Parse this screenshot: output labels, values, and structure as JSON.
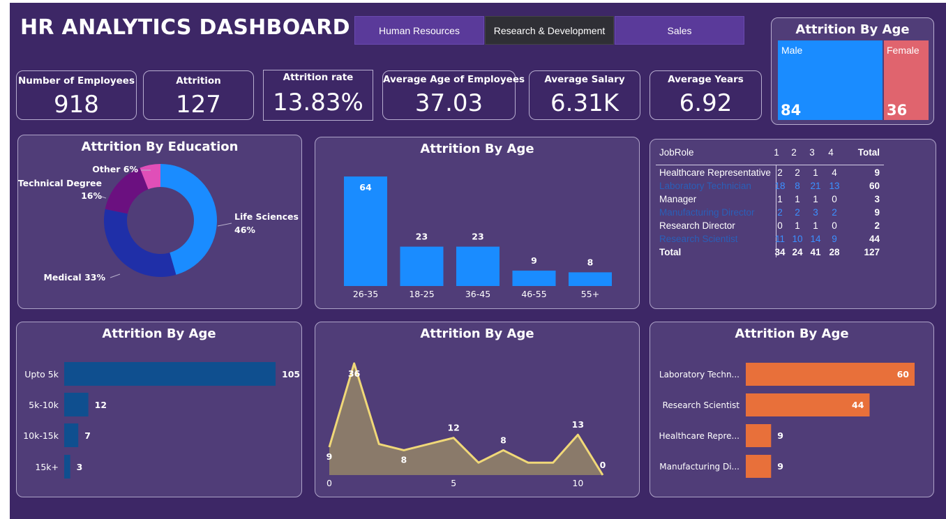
{
  "title": "HR ANALYTICS DASHBOARD",
  "tabs": [
    "Human Resources",
    "Research & Development",
    "Sales"
  ],
  "kpis": [
    {
      "label": "Number of Employees",
      "value": "918"
    },
    {
      "label": "Attrition",
      "value": "127"
    },
    {
      "label": "Attrition rate",
      "value": "13.83%"
    },
    {
      "label": "Average Age of Employees",
      "value": "37.03"
    },
    {
      "label": "Average Salary",
      "value": "6.31K"
    },
    {
      "label": "Average Years",
      "value": "6.92"
    }
  ],
  "gender_treemap": {
    "title": "Attrition By Age",
    "male_label": "Male",
    "male_value": "84",
    "male_color": "#1a8cff",
    "female_label": "Female",
    "female_value": "36",
    "female_color": "#e0646e"
  },
  "education_title": "Attrition By Education",
  "age_bar_title": "Attrition By Age",
  "salary_title": "Attrition By Age",
  "years_title": "Attrition By Age",
  "role_title": "Attrition By Age",
  "chart_data": [
    {
      "type": "pie",
      "title": "Attrition By Education",
      "categories": [
        "Life Sciences",
        "Medical",
        "Technical Degree",
        "Other"
      ],
      "values": [
        46,
        33,
        16,
        6
      ],
      "labels": [
        "Life Sciences 46%",
        "Medical 33%",
        "Technical Degree 16%",
        "Other 6%"
      ],
      "colors": [
        "#1a8cff",
        "#1f2fa8",
        "#6b1080",
        "#e04fb8"
      ]
    },
    {
      "type": "bar",
      "title": "Attrition By Age",
      "categories": [
        "26-35",
        "18-25",
        "36-45",
        "46-55",
        "55+"
      ],
      "values": [
        64,
        23,
        23,
        9,
        8
      ],
      "color": "#1a8cff"
    },
    {
      "type": "bar",
      "orientation": "horizontal",
      "title": "Attrition By Age",
      "categories": [
        "Upto 5k",
        "5k-10k",
        "10k-15k",
        "15k+"
      ],
      "values": [
        105,
        12,
        7,
        3
      ],
      "color": "#0f4f8f"
    },
    {
      "type": "area",
      "title": "Attrition By Age",
      "x": [
        0,
        1,
        2,
        3,
        4,
        5,
        6,
        7,
        8,
        9,
        10,
        11
      ],
      "y": [
        9,
        36,
        10,
        8,
        10,
        12,
        4,
        8,
        4,
        4,
        13,
        0
      ],
      "data_labels": [
        [
          0,
          "9"
        ],
        [
          1,
          "36"
        ],
        [
          3,
          "8"
        ],
        [
          5,
          "12"
        ],
        [
          7,
          "8"
        ],
        [
          10,
          "13"
        ],
        [
          11,
          "0"
        ]
      ],
      "x_ticks": [
        "0",
        "5",
        "10"
      ],
      "xlim": [
        0,
        11
      ],
      "ylim": [
        0,
        36
      ],
      "line_color": "#f0d878",
      "fill_color": "#8a7a6a"
    },
    {
      "type": "bar",
      "orientation": "horizontal",
      "title": "Attrition By Age",
      "categories": [
        "Laboratory Techn...",
        "Research Scientist",
        "Healthcare Repre...",
        "Manufacturing Di..."
      ],
      "values": [
        60,
        44,
        9,
        9
      ],
      "color": "#e8703a"
    },
    {
      "type": "table",
      "columns": [
        "JobRole",
        "1",
        "2",
        "3",
        "4",
        "Total"
      ],
      "rows": [
        {
          "role": "Healthcare Representative",
          "vals": [
            "2",
            "2",
            "1",
            "4"
          ],
          "total": "9",
          "dim": false
        },
        {
          "role": "Laboratory Technician",
          "vals": [
            "18",
            "8",
            "21",
            "13"
          ],
          "total": "60",
          "dim": true
        },
        {
          "role": "Manager",
          "vals": [
            "1",
            "1",
            "1",
            "0"
          ],
          "total": "3",
          "dim": false
        },
        {
          "role": "Manufacturing Director",
          "vals": [
            "2",
            "2",
            "3",
            "2"
          ],
          "total": "9",
          "dim": true
        },
        {
          "role": "Research Director",
          "vals": [
            "0",
            "1",
            "1",
            "0"
          ],
          "total": "2",
          "dim": false
        },
        {
          "role": "Research Scientist",
          "vals": [
            "11",
            "10",
            "14",
            "9"
          ],
          "total": "44",
          "dim": true
        }
      ],
      "total_row": {
        "role": "Total",
        "vals": [
          "34",
          "24",
          "41",
          "28"
        ],
        "total": "127"
      }
    }
  ]
}
